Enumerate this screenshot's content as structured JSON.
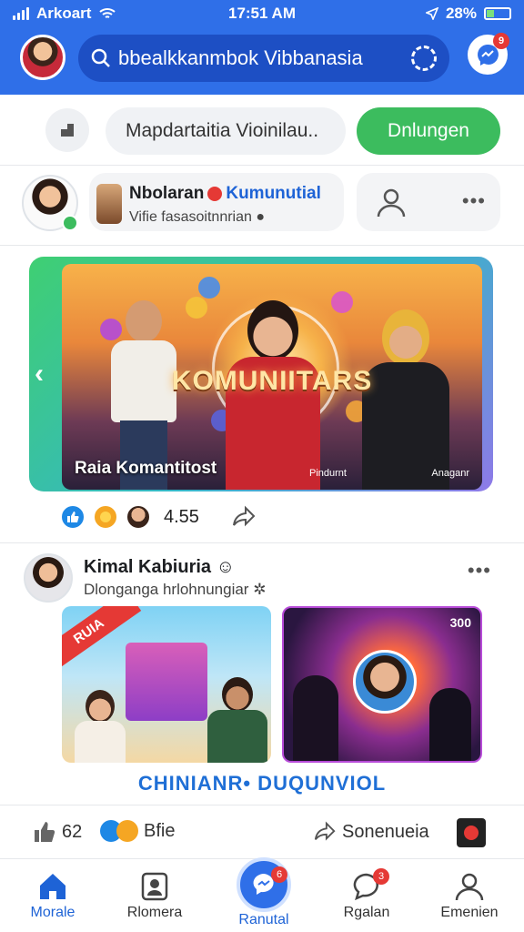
{
  "status": {
    "carrier": "Arkoart",
    "time": "17:51 AM",
    "battery": "28%"
  },
  "header": {
    "search_text": "bbealkkanmbok Vibbanasia",
    "message_badge": "9"
  },
  "composer": {
    "placeholder": "Mapdartaitia Vioinilau..",
    "button": "Dnlungen"
  },
  "stories": {
    "name": "Nbolaran",
    "name_highlight": "Kumunutial",
    "subtitle": "Vifie fasasoitnnrian"
  },
  "hero": {
    "title": "KOMUNIITARS",
    "caption": "Raia Komantitost",
    "caption_mid": "Pindurnt",
    "caption_right": "Anaganr"
  },
  "reactions": {
    "count": "4.55"
  },
  "post2": {
    "name": "Kimal Kabiuria",
    "subtitle": "Dlonganga hrlohnungiar",
    "image_ribbon": "RUIA",
    "image_tag": "300"
  },
  "banner": "CHINIANR• DUQUNVIOL",
  "actions": {
    "like_count": "62",
    "react_label": "Bfie",
    "share_label": "Sonenueia"
  },
  "tabs": [
    {
      "label": "Morale"
    },
    {
      "label": "Rlomera"
    },
    {
      "label": "Ranutal",
      "badge": "6"
    },
    {
      "label": "Rgalan",
      "badge": "3"
    },
    {
      "label": "Emenien"
    }
  ]
}
